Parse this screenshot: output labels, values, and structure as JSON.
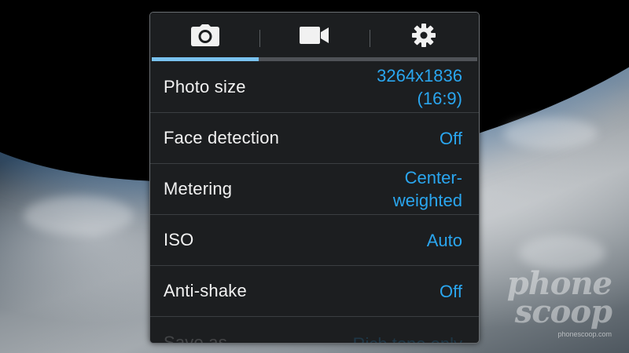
{
  "tabs": [
    {
      "icon": "camera-icon",
      "active": true
    },
    {
      "icon": "video-camera-icon",
      "active": false
    },
    {
      "icon": "gear-icon",
      "active": false
    }
  ],
  "settings": [
    {
      "label": "Photo size",
      "value_line1": "3264x1836",
      "value_line2": "(16:9)"
    },
    {
      "label": "Face detection",
      "value_line1": "Off",
      "value_line2": ""
    },
    {
      "label": "Metering",
      "value_line1": "Center-",
      "value_line2": "weighted"
    },
    {
      "label": "ISO",
      "value_line1": "Auto",
      "value_line2": ""
    },
    {
      "label": "Anti-shake",
      "value_line1": "Off",
      "value_line2": ""
    },
    {
      "label": "Save as",
      "value_line1": "Rich tone only",
      "value_line2": ""
    }
  ],
  "watermark": {
    "line1": "phone",
    "line2": "scoop",
    "site": "phonescoop.com"
  },
  "colors": {
    "accent": "#2aa6ef",
    "tab_active": "#79c2ef",
    "panel_bg": "#1c1e20",
    "label_text": "#f2f2f2"
  }
}
